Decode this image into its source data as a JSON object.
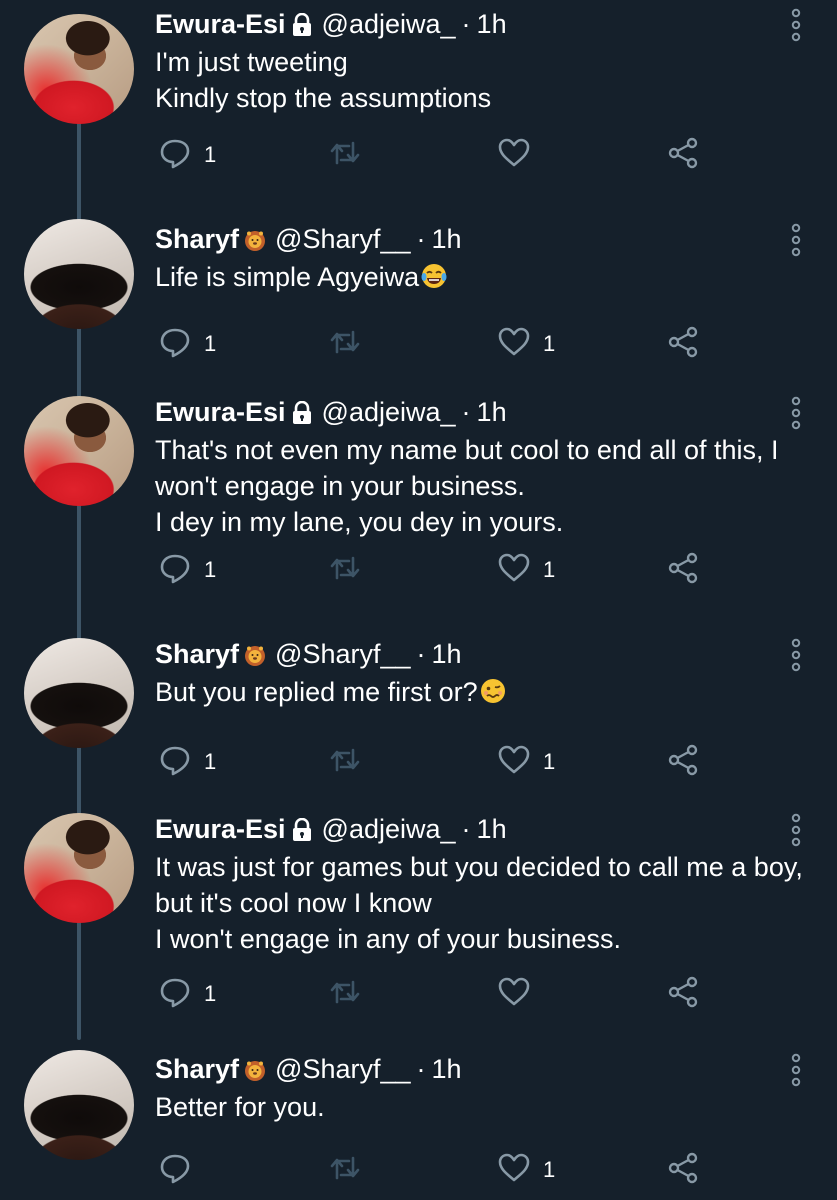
{
  "icons": {
    "reply": "reply-icon",
    "retweet": "retweet-icon",
    "like": "like-icon",
    "share": "share-icon",
    "more": "more-options-icon",
    "lock": "lock-icon",
    "lion": "lion-emoji"
  },
  "colors": {
    "background": "#15202b",
    "icon_gray": "#8899a6",
    "retweet_disabled": "#3d5466",
    "thread_line": "#3d5466"
  },
  "tweets": [
    {
      "name": "Ewura-Esi",
      "handle": "@adjeiwa_",
      "dot": "·",
      "time": "1h",
      "lines": [
        "I'm just tweeting",
        "Kindly stop the assumptions"
      ],
      "reply_count": "1",
      "like_count": ""
    },
    {
      "name": "Sharyf",
      "handle": "@Sharyf__",
      "dot": "·",
      "time": "1h",
      "lines": [
        "Life is simple Agyeiwa"
      ],
      "reply_count": "1",
      "like_count": "1"
    },
    {
      "name": "Ewura-Esi",
      "handle": "@adjeiwa_",
      "dot": "·",
      "time": "1h",
      "lines": [
        "That's not even my name but cool to end all of this, I",
        "won't engage in your business.",
        "I dey in my lane, you dey in yours."
      ],
      "reply_count": "1",
      "like_count": "1"
    },
    {
      "name": "Sharyf",
      "handle": "@Sharyf__",
      "dot": "·",
      "time": "1h",
      "lines": [
        "But you replied me first or?"
      ],
      "reply_count": "1",
      "like_count": "1"
    },
    {
      "name": "Ewura-Esi",
      "handle": "@adjeiwa_",
      "dot": "·",
      "time": "1h",
      "lines": [
        "It was just for games but you decided to call me a boy,",
        "but it's cool now I know",
        "I won't engage in any of your business."
      ],
      "reply_count": "1",
      "like_count": ""
    },
    {
      "name": "Sharyf",
      "handle": "@Sharyf__",
      "dot": "·",
      "time": "1h",
      "lines": [
        "Better for you."
      ],
      "reply_count": "",
      "like_count": "1"
    }
  ]
}
